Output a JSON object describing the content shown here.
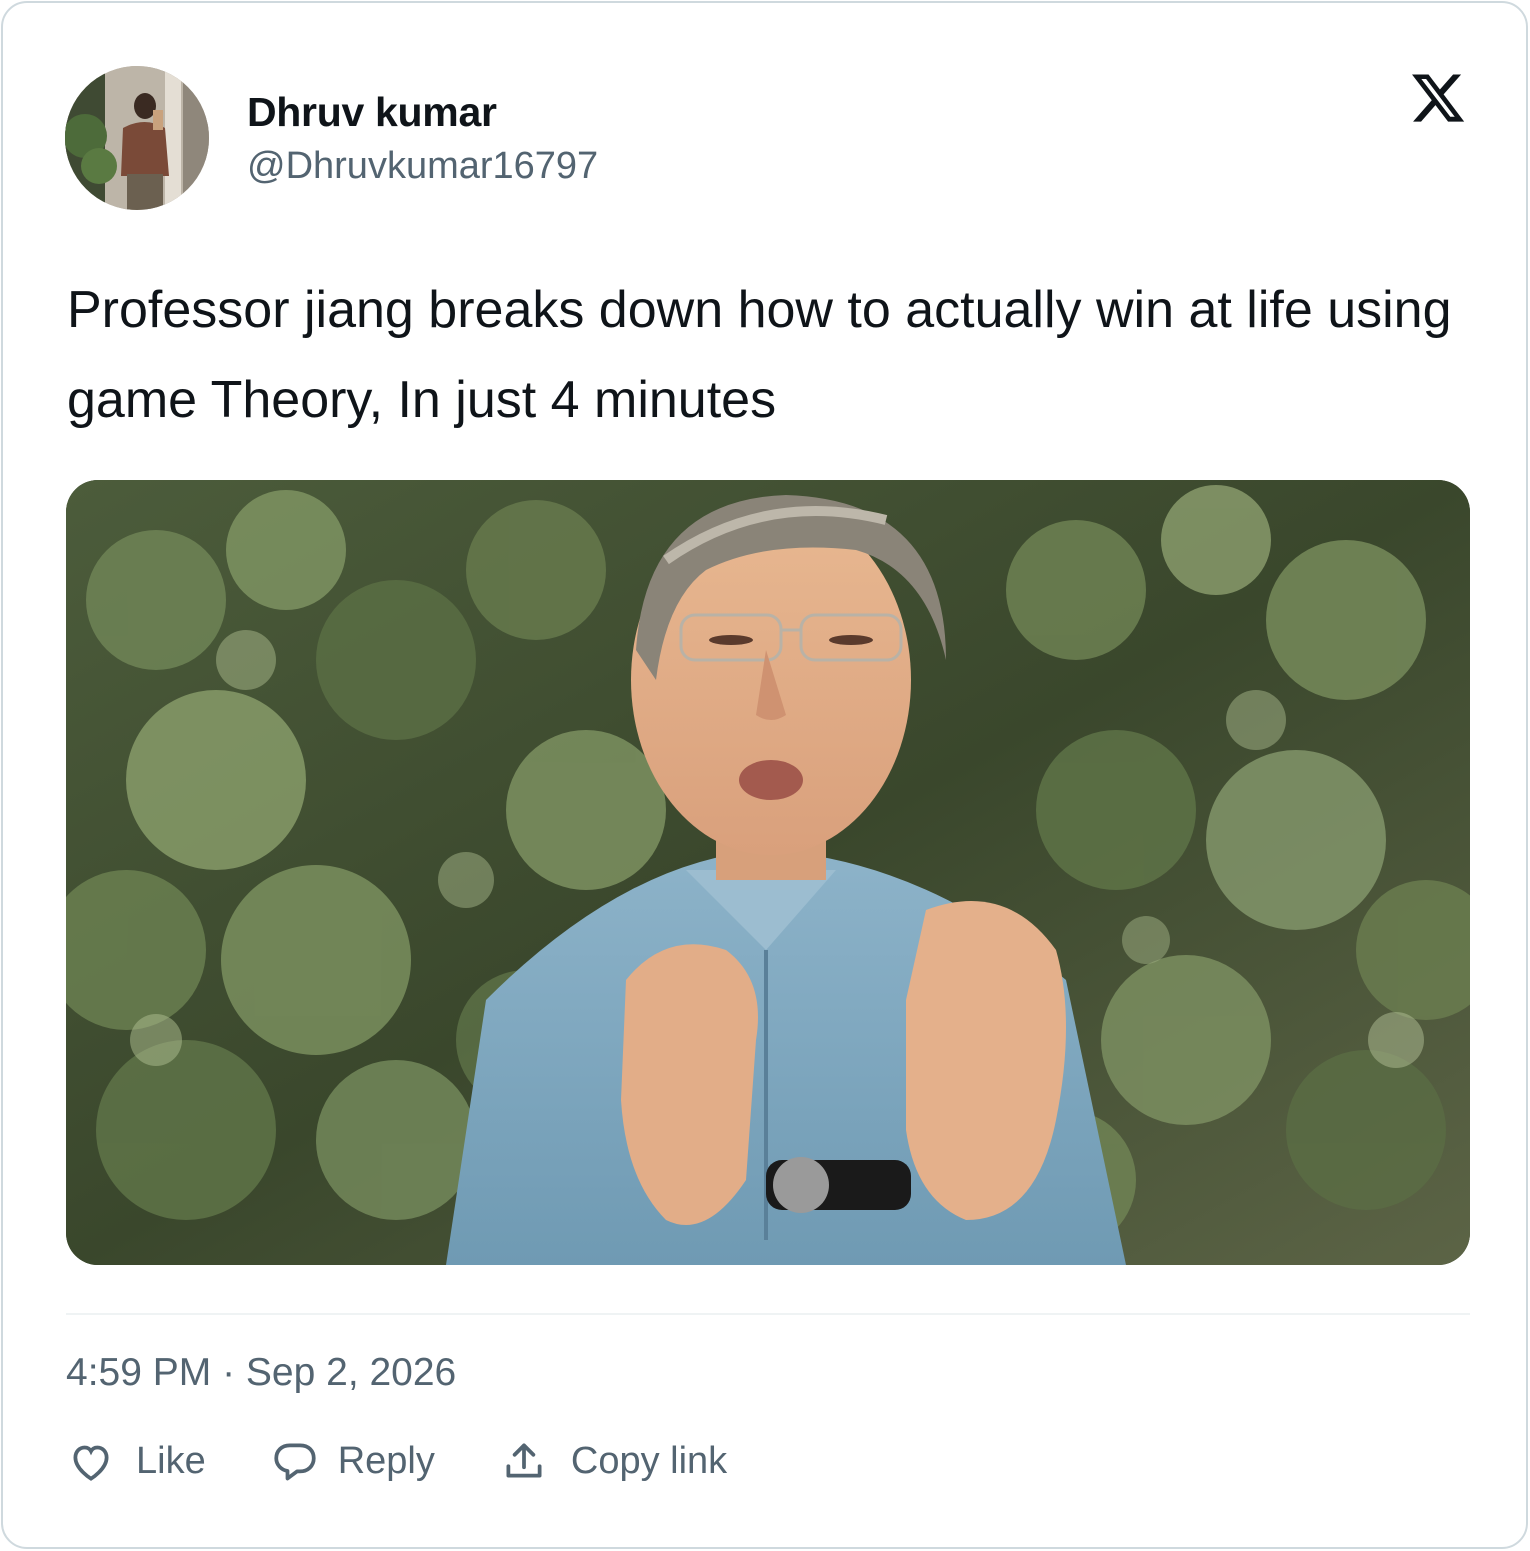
{
  "author": {
    "display_name": "Dhruv kumar",
    "handle": "@Dhruvkumar16797",
    "avatar_icon": "user-avatar-photo"
  },
  "platform_icon": "x-logo-icon",
  "tweet": {
    "text": "Professor jiang breaks down how to actually win at life using game Theory, In just 4 minutes",
    "media_icon": "video-thumbnail"
  },
  "meta": {
    "timestamp": "4:59 PM · Sep 2, 2026"
  },
  "actions": {
    "like_label": "Like",
    "reply_label": "Reply",
    "copy_link_label": "Copy link"
  },
  "colors": {
    "text_primary": "#0f1419",
    "text_secondary": "#536471",
    "border": "#cfd9de",
    "divider": "#eff3f4"
  }
}
